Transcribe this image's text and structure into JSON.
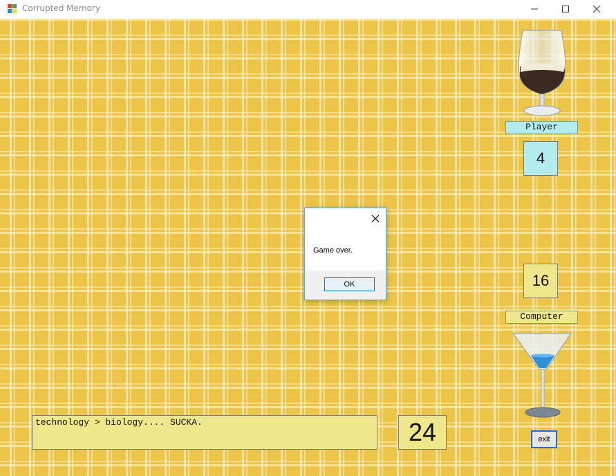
{
  "window": {
    "title": "Corrupted Memory",
    "icon": "app-icon",
    "controls": [
      "minimize-icon",
      "maximize-icon",
      "close-icon"
    ]
  },
  "player": {
    "label": "Player",
    "score": "4",
    "glass_icon": "beer-glass-icon"
  },
  "computer": {
    "label": "Computer",
    "score": "16",
    "glass_icon": "martini-glass-icon"
  },
  "message": "technology > biology.... SUCKA.",
  "remaining": "24",
  "exit_label": "exit",
  "dialog": {
    "message": "Game over.",
    "ok_label": "OK"
  },
  "colors": {
    "background_plaid": "#ecc447",
    "player_box": "#b2ecee",
    "computer_box": "#f0e68c",
    "dialog_button_border": "#0078d7"
  }
}
